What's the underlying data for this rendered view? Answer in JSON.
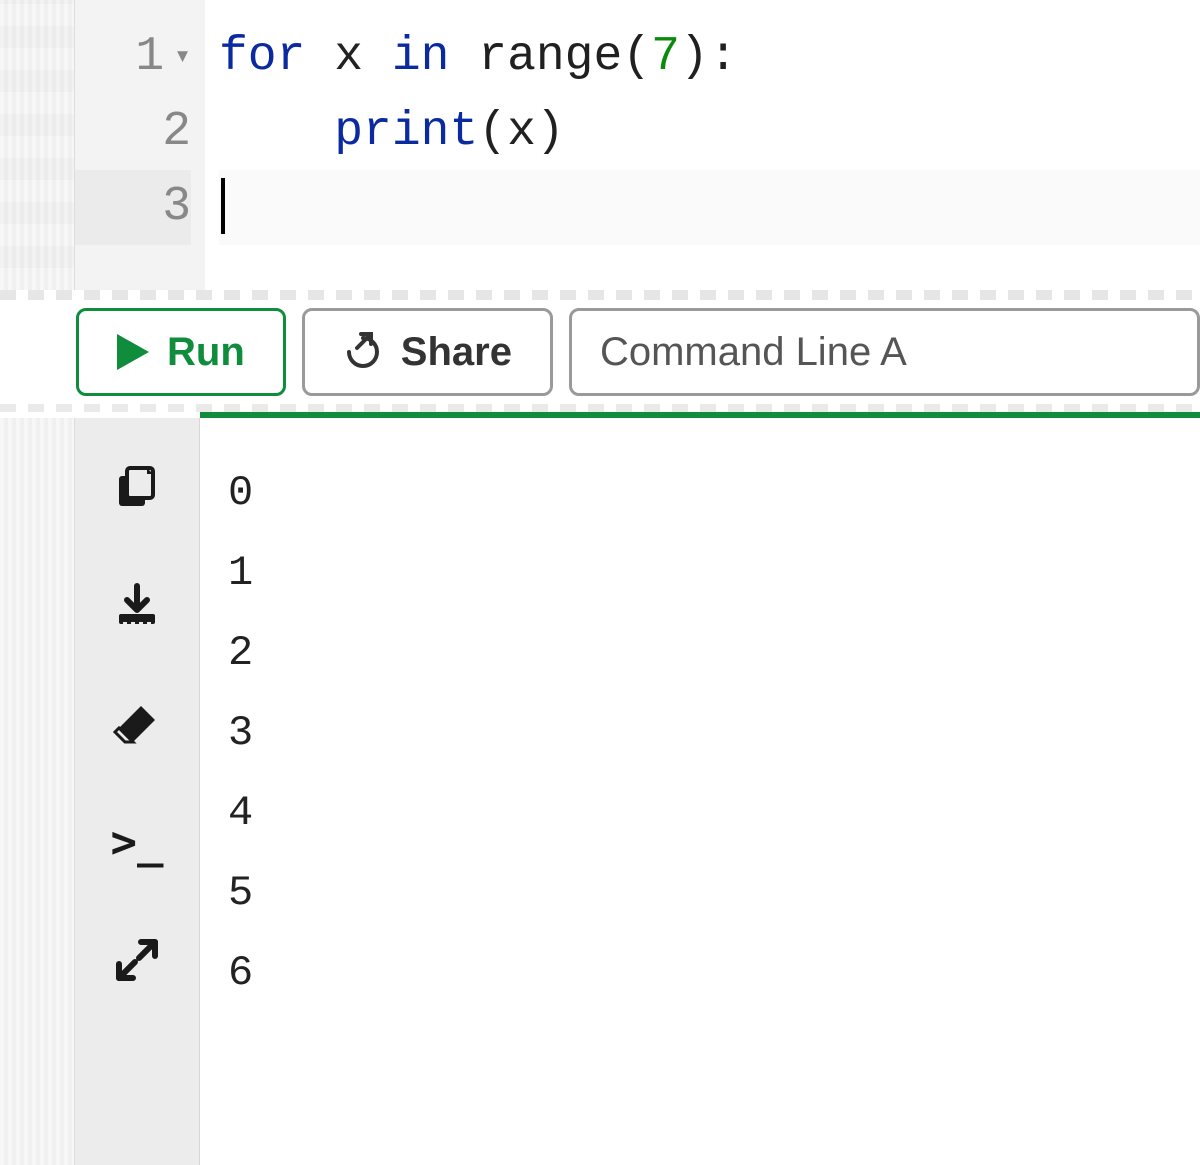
{
  "editor": {
    "lines": [
      {
        "num": "1",
        "foldable": true,
        "tokens": [
          {
            "t": "kw",
            "v": "for"
          },
          {
            "t": "sp",
            "v": " "
          },
          {
            "t": "id",
            "v": "x"
          },
          {
            "t": "sp",
            "v": " "
          },
          {
            "t": "kw",
            "v": "in"
          },
          {
            "t": "sp",
            "v": " "
          },
          {
            "t": "builtin",
            "v": "range"
          },
          {
            "t": "punc",
            "v": "("
          },
          {
            "t": "num",
            "v": "7"
          },
          {
            "t": "punc",
            "v": ")"
          },
          {
            "t": "punc",
            "v": ":"
          }
        ]
      },
      {
        "num": "2",
        "tokens": [
          {
            "t": "indent",
            "v": "    "
          },
          {
            "t": "fn",
            "v": "print"
          },
          {
            "t": "punc",
            "v": "("
          },
          {
            "t": "id",
            "v": "x"
          },
          {
            "t": "punc",
            "v": ")"
          }
        ]
      },
      {
        "num": "3",
        "active": true,
        "cursor": true,
        "tokens": []
      }
    ]
  },
  "buttons": {
    "run": "Run",
    "share": "Share",
    "cmd": "Command Line A"
  },
  "output_toolbar": {
    "copy": "copy-icon",
    "download": "download-icon",
    "erase": "eraser-icon",
    "prompt": ">_",
    "fullscreen": "fullscreen-icon"
  },
  "output": [
    "0",
    "1",
    "2",
    "3",
    "4",
    "5",
    "6"
  ]
}
